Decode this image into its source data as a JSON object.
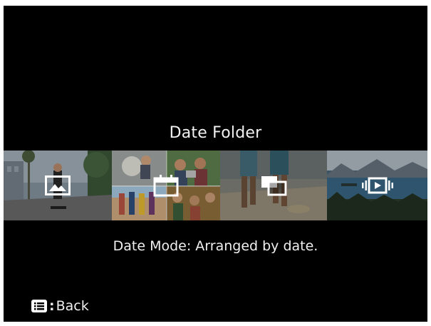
{
  "screen": {
    "title": "Date Folder",
    "description": "Date Mode: Arranged by date."
  },
  "view_modes": [
    {
      "name": "single-image",
      "icon": "picture-icon",
      "selected": false
    },
    {
      "name": "date-folder",
      "icon": "calendar-icon",
      "selected": true
    },
    {
      "name": "multi-image",
      "icon": "stacked-pictures-icon",
      "selected": false
    },
    {
      "name": "movie",
      "icon": "filmstrip-play-icon",
      "selected": false
    }
  ],
  "footer": {
    "key_icon": "menu-key-icon",
    "separator": ":",
    "label": "Back"
  },
  "colors": {
    "background": "#000000",
    "text": "#f0f0f0"
  }
}
